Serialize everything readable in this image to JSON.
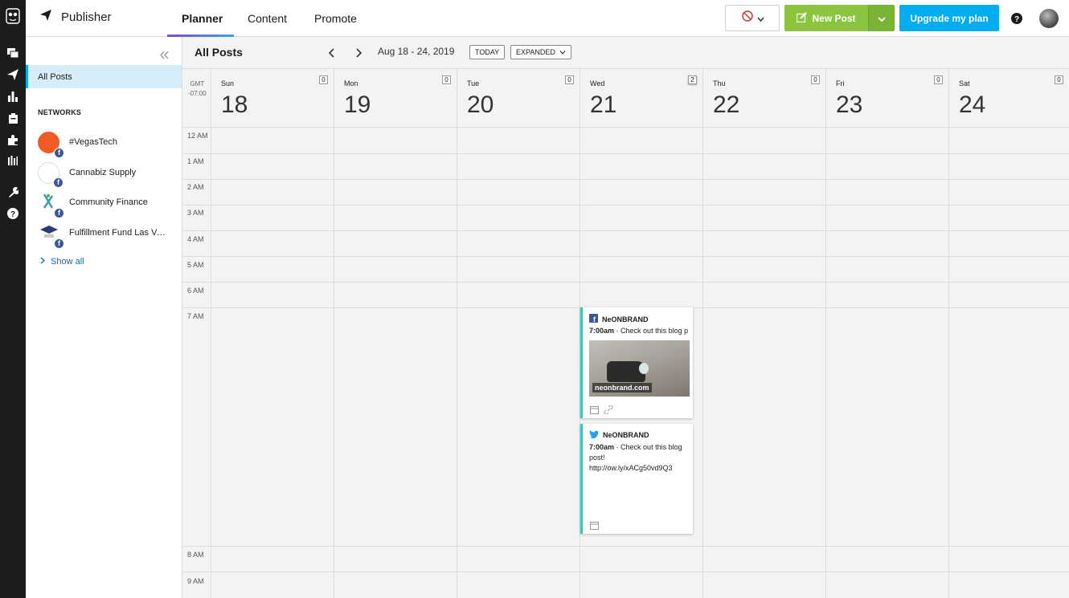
{
  "app": {
    "title": "Publisher"
  },
  "tabs": [
    "Planner",
    "Content",
    "Promote"
  ],
  "header": {
    "new_post": "New Post",
    "upgrade": "Upgrade my plan"
  },
  "sidebar": {
    "all_posts": "All Posts",
    "networks_heading": "NETWORKS",
    "networks": [
      {
        "label": "#VegasTech"
      },
      {
        "label": "Cannabiz Supply"
      },
      {
        "label": "Community Finance"
      },
      {
        "label": "Fulfillment Fund Las Ve..."
      }
    ],
    "show_all": "Show all"
  },
  "main": {
    "title": "All Posts",
    "date_range": "Aug 18 - 24, 2019",
    "today": "TODAY",
    "view": "EXPANDED",
    "timezone": "GMT\n-07:00",
    "days": [
      {
        "name": "Sun",
        "num": "18",
        "count": "0"
      },
      {
        "name": "Mon",
        "num": "19",
        "count": "0"
      },
      {
        "name": "Tue",
        "num": "20",
        "count": "0"
      },
      {
        "name": "Wed",
        "num": "21",
        "count": "2"
      },
      {
        "name": "Thu",
        "num": "22",
        "count": "0"
      },
      {
        "name": "Fri",
        "num": "23",
        "count": "0"
      },
      {
        "name": "Sat",
        "num": "24",
        "count": "0"
      }
    ],
    "hours": [
      "12 AM",
      "1 AM",
      "2 AM",
      "3 AM",
      "4 AM",
      "5 AM",
      "6 AM",
      "7 AM",
      "8 AM",
      "9 AM"
    ]
  },
  "posts": [
    {
      "network": "facebook",
      "account": "NeONBRAND",
      "time": "7:00am",
      "text": "· Check out this blog p",
      "link_caption": "neonbrand.com"
    },
    {
      "network": "twitter",
      "account": "NeONBRAND",
      "time": "7:00am",
      "text": "· Check out this blog",
      "text2": "post!",
      "text3": "http://ow.ly/xACg50vd9Q3"
    }
  ],
  "colors": {
    "accent": "#00aeef",
    "new_post": "#8bc53f",
    "card_border": "#3fc7b7",
    "rail": "#1c1c1c"
  }
}
